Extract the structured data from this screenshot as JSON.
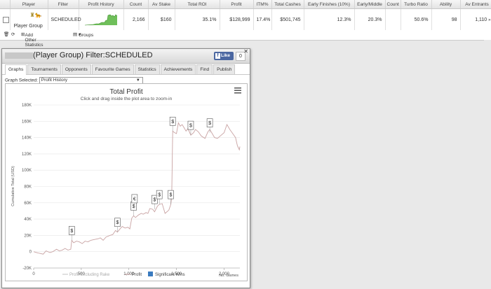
{
  "table": {
    "headers": [
      "",
      "Player",
      "Filter",
      "Profit History",
      "Count",
      "Av Stake",
      "Total ROI",
      "Profit",
      "ITM%",
      "Total Cashes",
      "Early Finishes (10%)",
      "Early/Middle",
      "Count",
      "Turbo Ratio",
      "Ability",
      "Av Entrants"
    ],
    "row": {
      "player": "Player Group",
      "filter": "SCHEDULED",
      "count": "2,166",
      "av_stake": "$160",
      "total_roi": "35.1%",
      "profit": "$128,999",
      "itm": "17.4%",
      "total_cashes": "$501,745",
      "early_finishes": "12.3%",
      "early_middle": "20.3%",
      "count2": "",
      "turbo_ratio": "50.6%",
      "ability": "98",
      "av_entrants": "1,110"
    }
  },
  "toolbar": {
    "add_stats": "Add Other Statistics",
    "groups": "Groups"
  },
  "window": {
    "title": "(Player Group) Filter:SCHEDULED",
    "like": "Like",
    "like_count": "0",
    "tabs": [
      "Graphs",
      "Tournaments",
      "Opponents",
      "Favourite Games",
      "Statistics",
      "Achievements",
      "Find",
      "Publish"
    ],
    "graph_selected_label": "Graph Selected:",
    "graph_selected_value": "Profit History"
  },
  "chart_data": {
    "type": "line",
    "title": "Total Profit",
    "subtitle": "Click and drag inside the plot area to zoom-in",
    "ylabel": "Cumulative Total (USD)",
    "xlabel": "No. Games",
    "xlim": [
      0,
      2166
    ],
    "ylim": [
      -20000,
      180000
    ],
    "xticks": [
      "0",
      "500",
      "1,000",
      "1,500",
      "2,000"
    ],
    "xtick_values": [
      0,
      500,
      1000,
      1500,
      2000
    ],
    "yticks": [
      "-20K",
      "0",
      "20K",
      "40K",
      "60K",
      "80K",
      "100K",
      "120K",
      "140K",
      "160K",
      "180K"
    ],
    "ytick_values": [
      -20000,
      0,
      20000,
      40000,
      60000,
      80000,
      100000,
      120000,
      140000,
      160000,
      180000
    ],
    "legend": [
      "Profit Excluding Rake",
      "Profit",
      "Significant Wins"
    ],
    "series": [
      {
        "name": "Profit",
        "color": "#c9a3a3",
        "x": [
          0,
          30,
          60,
          100,
          130,
          170,
          200,
          240,
          270,
          300,
          330,
          360,
          390,
          400,
          420,
          450,
          480,
          510,
          540,
          570,
          600,
          640,
          680,
          700,
          730,
          760,
          800,
          830,
          860,
          880,
          900,
          930,
          960,
          990,
          1000,
          1010,
          1030,
          1050,
          1070,
          1100,
          1130,
          1150,
          1180,
          1200,
          1220,
          1250,
          1270,
          1300,
          1320,
          1350,
          1380,
          1400,
          1420,
          1440,
          1450,
          1460,
          1480,
          1500,
          1520,
          1540,
          1560,
          1580,
          1600,
          1620,
          1650,
          1680,
          1700,
          1730,
          1760,
          1800,
          1830,
          1850,
          1870,
          1900,
          1930,
          1960,
          2000,
          2030,
          2060,
          2090,
          2120,
          2140,
          2160,
          2166
        ],
        "y": [
          0,
          -1000,
          -2000,
          -3000,
          1000,
          -1000,
          0,
          3000,
          1000,
          2000,
          4000,
          2000,
          3000,
          14000,
          11000,
          13000,
          12000,
          10000,
          13000,
          12000,
          14000,
          15000,
          16000,
          17000,
          14000,
          18000,
          20000,
          21000,
          26000,
          24000,
          27000,
          31000,
          29000,
          30000,
          29000,
          28000,
          41000,
          44000,
          42000,
          45000,
          47000,
          46000,
          48000,
          47000,
          53000,
          52000,
          49000,
          56000,
          58000,
          59000,
          47000,
          49000,
          51000,
          58000,
          67000,
          148000,
          146000,
          145000,
          158000,
          154000,
          156000,
          152000,
          148000,
          151000,
          143000,
          146000,
          150000,
          147000,
          142000,
          139000,
          147000,
          150000,
          146000,
          140000,
          139000,
          142000,
          146000,
          156000,
          150000,
          145000,
          140000,
          130000,
          125000,
          129000
        ]
      },
      {
        "name": "Profit Excluding Rake",
        "color": "#c0c0c0",
        "x": [],
        "y": []
      }
    ],
    "significant_wins": [
      {
        "x": 400,
        "y": 14000,
        "label": "$"
      },
      {
        "x": 880,
        "y": 24000,
        "label": "$"
      },
      {
        "x": 1050,
        "y": 44000,
        "label": "$"
      },
      {
        "x": 1060,
        "y": 53000,
        "label": "€"
      },
      {
        "x": 1270,
        "y": 52000,
        "label": "$"
      },
      {
        "x": 1320,
        "y": 58000,
        "label": "$"
      },
      {
        "x": 1440,
        "y": 58000,
        "label": "$"
      },
      {
        "x": 1460,
        "y": 148000,
        "label": "$"
      },
      {
        "x": 1650,
        "y": 143000,
        "label": "$"
      },
      {
        "x": 1850,
        "y": 146000,
        "label": "$"
      }
    ],
    "colors": {
      "profit": "#c9a3a3",
      "excluding_rake": "#c0c0c0",
      "wins": "#3a7bbf"
    }
  }
}
